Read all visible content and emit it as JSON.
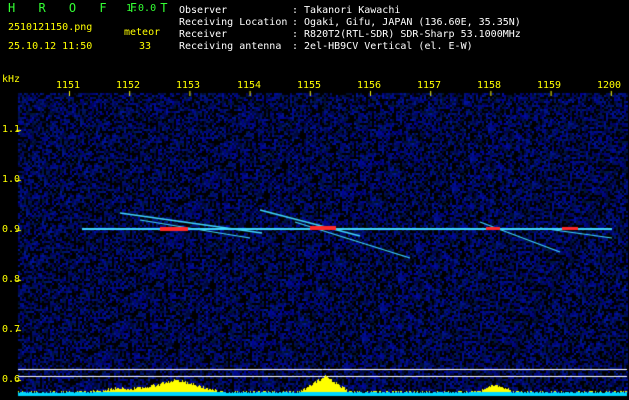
{
  "header": {
    "app_title": "H R O F F T",
    "app_version": "1.0.0",
    "filename": "2510121150.png",
    "datetime": "25.10.12 11:50",
    "mode_label": "meteor",
    "mode_count": "33",
    "info_labels": [
      "Observer",
      "Receiving Location",
      "Receiver",
      "Receiving antenna"
    ],
    "info_values": [
      ": Takanori Kawachi",
      ": Ogaki, Gifu, JAPAN (136.60E, 35.35N)",
      ": R820T2(RTL-SDR) SDR-Sharp 53.1000MHz",
      ": 2el-HB9CV Vertical (el. E-W)"
    ]
  },
  "axes": {
    "x_unit": "kHz",
    "x_ticks": [
      "1151",
      "1152",
      "1153",
      "1154",
      "1155",
      "1156",
      "1157",
      "1158",
      "1159",
      "1200"
    ],
    "y_ticks": [
      "1.1",
      "1.0",
      "0.9",
      "0.8",
      "0.7",
      "0.6"
    ]
  },
  "colors": {
    "header_text": "#33ff33",
    "info_text": "#ffffff",
    "label_text": "#ffff00",
    "noise_bg": "#00003a",
    "signal": "#3fd8ff",
    "signal_hot": "#ff2a2a",
    "bar_cyan": "#00d8ff",
    "bar_yellow": "#ffff00"
  }
}
